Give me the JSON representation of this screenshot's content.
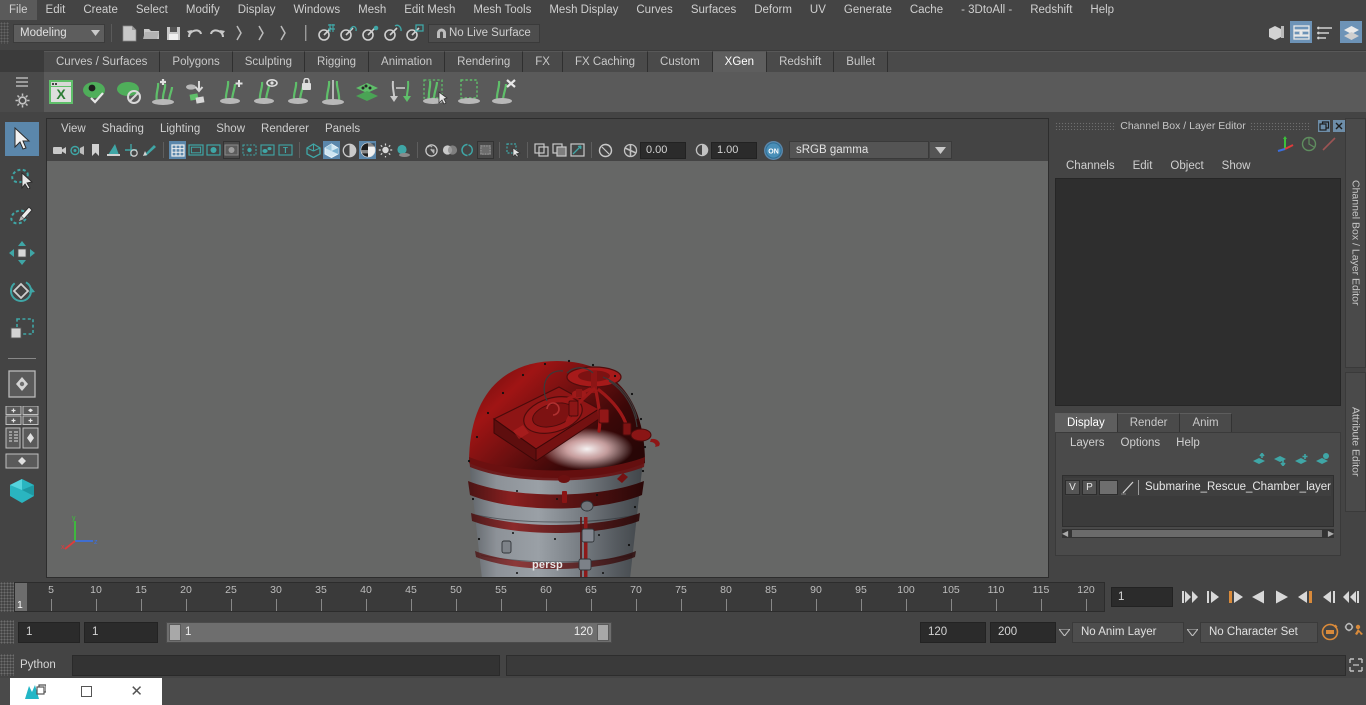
{
  "app": {
    "name": "Autodesk Maya",
    "mode": "Modeling",
    "live_surface": "No Live Surface"
  },
  "menubar": {
    "items": [
      "File",
      "Edit",
      "Create",
      "Select",
      "Modify",
      "Display",
      "Windows",
      "Mesh",
      "Edit Mesh",
      "Mesh Tools",
      "Mesh Display",
      "Curves",
      "Surfaces",
      "Deform",
      "UV",
      "Generate",
      "Cache",
      "- 3DtoAll -",
      "Redshift",
      "Help"
    ]
  },
  "statusline": {
    "mode_label": "Modeling",
    "live_surface_label": "No Live Surface",
    "icons": [
      "new-scene-icon",
      "open-scene-icon",
      "save-scene-icon",
      "undo-icon",
      "redo-icon",
      "select-by-hierarchy-icon",
      "select-by-object-icon",
      "select-by-component-icon",
      "snap-to-grid-icon",
      "snap-to-curve-icon",
      "snap-to-point-icon",
      "snap-to-projected-center-icon",
      "snap-to-view-plane-icon",
      "make-live-icon"
    ],
    "right_icons": [
      "show-hide-modeling-toolkit-icon",
      "show-hide-attribute-editor-icon",
      "show-hide-tool-settings-icon",
      "show-hide-channel-box-icon"
    ]
  },
  "shelf": {
    "tabs": [
      "Curves / Surfaces",
      "Polygons",
      "Sculpting",
      "Rigging",
      "Animation",
      "Rendering",
      "FX",
      "FX Caching",
      "Custom",
      "XGen",
      "Redshift",
      "Bullet"
    ],
    "active_tab": "XGen",
    "icons": [
      "xgen-editor-icon",
      "xgen-preview-icon",
      "xgen-clear-preview-icon",
      "xgen-add-groom-icon",
      "xgen-place-guides-icon",
      "xgen-add-guide-icon",
      "xgen-guide-visibility-icon",
      "xgen-lock-guide-icon",
      "xgen-mirror-guides-icon",
      "xgen-layers-icon",
      "xgen-transfer-icon",
      "xgen-select-guides-icon",
      "xgen-select-region-icon",
      "xgen-delete-guides-icon"
    ]
  },
  "toolbox": {
    "tools": [
      {
        "name": "select-tool",
        "selected": true
      },
      {
        "name": "lasso-select-tool",
        "selected": false
      },
      {
        "name": "paint-select-tool",
        "selected": false
      },
      {
        "name": "move-tool",
        "selected": false
      },
      {
        "name": "rotate-tool",
        "selected": false
      },
      {
        "name": "scale-tool",
        "selected": false
      }
    ],
    "layout_icons": [
      "single-perspective-layout-icon",
      "four-view-layout-icon",
      "outliner-persp-layout-icon",
      "hypergraph-persp-layout-icon",
      "persp-graph-layout-icon"
    ]
  },
  "viewport": {
    "menus": [
      "View",
      "Shading",
      "Lighting",
      "Show",
      "Renderer",
      "Panels"
    ],
    "camera_label": "persp",
    "exposure": "0.00",
    "gamma": "1.00",
    "view_transform": "sRGB gamma",
    "color_management_toggle": "ON",
    "toolbar_icons": [
      "select-camera-icon",
      "camera-attributes-icon",
      "bookmark-icon",
      "image-plane-icon",
      "2d-pan-zoom-icon",
      "grease-pencil-icon",
      "grid-toggle-icon",
      "film-gate-icon",
      "resolution-gate-icon",
      "gate-mask-icon",
      "exposure-icon",
      "film-origin-icon",
      "texture-border-icon",
      "wireframe-icon",
      "smooth-shade-icon",
      "shade-all-icon",
      "smooth-shade-all-icon",
      "wireframe-on-shaded-icon",
      "textured-icon",
      "lights-icon",
      "shadows-icon",
      "screen-space-ao-icon",
      "motion-blur-icon",
      "multisample-icon",
      "depth-of-field-icon",
      "isolate-select-icon",
      "xray-icon",
      "xray-joints-icon",
      "xray-active-components-icon",
      "viewport-refresh-icon"
    ]
  },
  "channel_box": {
    "title": "Channel Box / Layer Editor",
    "menus": [
      "Channels",
      "Edit",
      "Object",
      "Show"
    ],
    "window_buttons": [
      "restore-icon",
      "close-icon"
    ],
    "gizmo_icons": [
      "axis-gizmo-icon",
      "circle-gizmo-icon",
      "slash-gizmo-icon"
    ]
  },
  "layer_editor": {
    "tabs": [
      "Display",
      "Render",
      "Anim"
    ],
    "active_tab": "Display",
    "menus": [
      "Layers",
      "Options",
      "Help"
    ],
    "toolbar_icons": [
      "move-layer-up-icon",
      "move-layer-down-icon",
      "new-layer-from-selected-icon",
      "new-layer-icon"
    ],
    "layers": [
      {
        "visibility": "V",
        "playback": "P",
        "color_swatch": "",
        "name": "Submarine_Rescue_Chamber_layer"
      }
    ]
  },
  "side_tabs": [
    "Channel Box / Layer Editor",
    "Attribute Editor"
  ],
  "timeslider": {
    "ticks": [
      5,
      10,
      15,
      20,
      25,
      30,
      35,
      40,
      45,
      50,
      55,
      60,
      65,
      70,
      75,
      80,
      85,
      90,
      95,
      100,
      105,
      110,
      115,
      120
    ],
    "current_frame": "1",
    "current_frame_field": "1",
    "transport_icons": [
      "go-to-start-icon",
      "step-back-keyframe-icon",
      "step-back-frame-icon",
      "play-backwards-icon",
      "play-forwards-icon",
      "step-forward-frame-icon",
      "step-forward-keyframe-icon",
      "go-to-end-icon"
    ]
  },
  "range_slider": {
    "anim_start": "1",
    "range_start": "1",
    "bar_start_label": "1",
    "bar_end_label": "120",
    "range_end": "120",
    "anim_end": "200",
    "anim_layer": "No Anim Layer",
    "character_set": "No Character Set",
    "right_icons": [
      "auto-key-icon",
      "animation-preferences-icon"
    ]
  },
  "command_line": {
    "language": "Python",
    "input_value": "",
    "output_value": "",
    "script_editor_icon": "script-editor-icon"
  },
  "taskbar": {
    "items": [
      "maya-app-icon",
      "restore-window-icon",
      "maximize-window-icon",
      "close-window-icon"
    ]
  },
  "colors": {
    "accent_blue": "#5b87ab",
    "teal": "#3fa6a6",
    "xgen_green": "#5fbf6a",
    "panel_bg": "#444444",
    "viewport_bg": "#666766",
    "model_red": "#8e1212",
    "model_grey": "#8d9298",
    "orange": "#d98a3a"
  }
}
